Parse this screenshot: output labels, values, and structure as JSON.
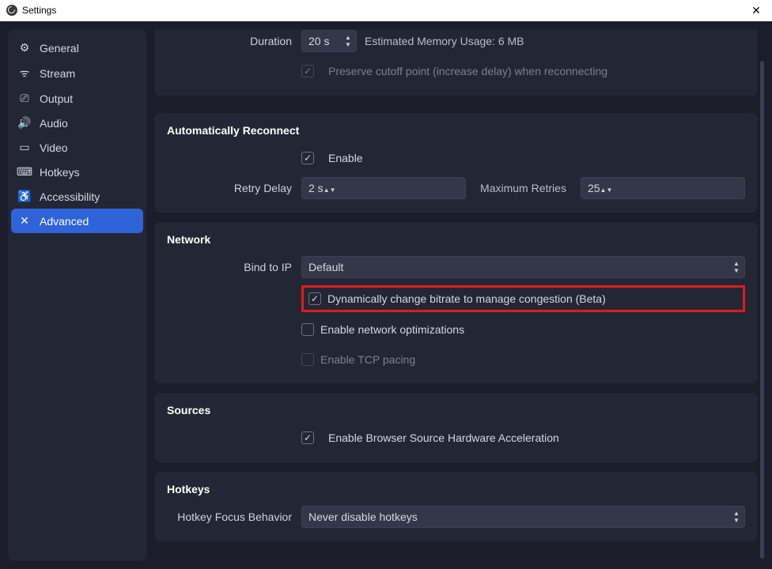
{
  "window": {
    "title": "Settings"
  },
  "sidebar": {
    "items": [
      {
        "label": "General",
        "icon": "⚙"
      },
      {
        "label": "Stream",
        "icon": "ᯤ"
      },
      {
        "label": "Output",
        "icon": "⎚"
      },
      {
        "label": "Audio",
        "icon": "🔊"
      },
      {
        "label": "Video",
        "icon": "▭"
      },
      {
        "label": "Hotkeys",
        "icon": "⌨"
      },
      {
        "label": "Accessibility",
        "icon": "♿"
      },
      {
        "label": "Advanced",
        "icon": "✕"
      }
    ],
    "active_index": 7
  },
  "delay_section": {
    "duration_label": "Duration",
    "duration_value": "20 s",
    "estimate_text": "Estimated Memory Usage: 6 MB",
    "preserve_label": "Preserve cutoff point (increase delay) when reconnecting"
  },
  "reconnect_section": {
    "title": "Automatically Reconnect",
    "enable_label": "Enable",
    "retry_delay_label": "Retry Delay",
    "retry_delay_value": "2 s",
    "max_retries_label": "Maximum Retries",
    "max_retries_value": "25"
  },
  "network_section": {
    "title": "Network",
    "bind_ip_label": "Bind to IP",
    "bind_ip_value": "Default",
    "dyn_bitrate_label": "Dynamically change bitrate to manage congestion (Beta)",
    "net_opt_label": "Enable network optimizations",
    "tcp_pacing_label": "Enable TCP pacing"
  },
  "sources_section": {
    "title": "Sources",
    "browser_hw_label": "Enable Browser Source Hardware Acceleration"
  },
  "hotkeys_section": {
    "title": "Hotkeys",
    "focus_label": "Hotkey Focus Behavior",
    "focus_value": "Never disable hotkeys"
  }
}
